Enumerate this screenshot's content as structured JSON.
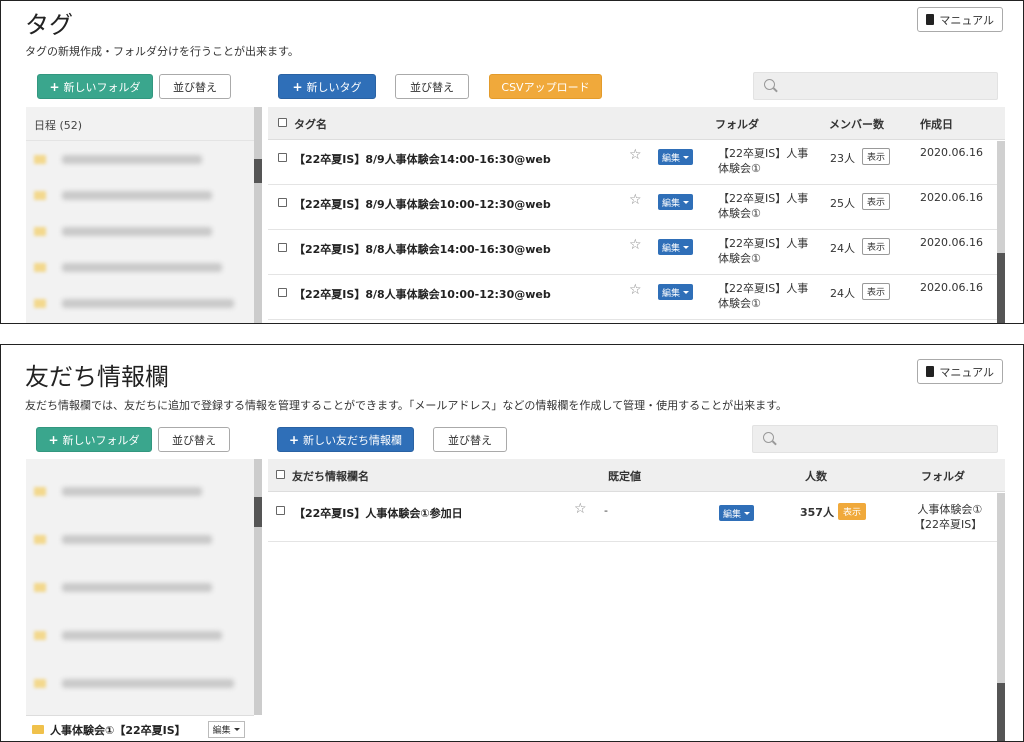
{
  "tags": {
    "title": "タグ",
    "description": "タグの新規作成・フォルダ分けを行うことが出来ます。",
    "manual_label": "マニュアル",
    "new_folder_label": "新しいフォルダ",
    "sort_label": "並び替え",
    "new_tag_label": "新しいタグ",
    "sort_label_2": "並び替え",
    "csv_upload_label": "CSVアップロード",
    "search_placeholder": "",
    "sidebar_head": "日程 (52)",
    "columns": {
      "name": "タグ名",
      "folder": "フォルダ",
      "members": "メンバー数",
      "created": "作成日"
    },
    "rows": [
      {
        "name": "【22卒夏IS】8/9人事体験会14:00-16:30@web",
        "edit": "編集",
        "folder_line1": "【22卒夏IS】人事",
        "folder_line2": "体験会①",
        "members": "23人",
        "show": "表示",
        "created": "2020.06.16"
      },
      {
        "name": "【22卒夏IS】8/9人事体験会10:00-12:30@web",
        "edit": "編集",
        "folder_line1": "【22卒夏IS】人事",
        "folder_line2": "体験会①",
        "members": "25人",
        "show": "表示",
        "created": "2020.06.16"
      },
      {
        "name": "【22卒夏IS】8/8人事体験会14:00-16:30@web",
        "edit": "編集",
        "folder_line1": "【22卒夏IS】人事",
        "folder_line2": "体験会①",
        "members": "24人",
        "show": "表示",
        "created": "2020.06.16"
      },
      {
        "name": "【22卒夏IS】8/8人事体験会10:00-12:30@web",
        "edit": "編集",
        "folder_line1": "【22卒夏IS】人事",
        "folder_line2": "体験会①",
        "members": "24人",
        "show": "表示",
        "created": "2020.06.16"
      }
    ]
  },
  "friends": {
    "title": "友だち情報欄",
    "description": "友だち情報欄では、友だちに追加で登録する情報を管理することができます。「メールアドレス」などの情報欄を作成して管理・使用することが出来ます。",
    "manual_label": "マニュアル",
    "new_folder_label": "新しいフォルダ",
    "sort_label": "並び替え",
    "new_field_label": "新しい友だち情報欄",
    "sort_label_2": "並び替え",
    "search_placeholder": "",
    "columns": {
      "name": "友だち情報欄名",
      "default": "既定値",
      "count": "人数",
      "folder": "フォルダ"
    },
    "rows": [
      {
        "name": "【22卒夏IS】人事体験会①参加日",
        "default": "-",
        "edit": "編集",
        "count": "357人",
        "show": "表示",
        "folder_line1": "人事体験会①",
        "folder_line2": "【22卒夏IS】"
      }
    ],
    "active_folder": "人事体験会①【22卒夏IS】",
    "active_folder_edit": "編集"
  },
  "icons": {
    "manual": "book-icon",
    "search": "search-icon",
    "star": "star-icon",
    "folder": "folder-icon"
  },
  "colors": {
    "green": "#3aa68d",
    "blue": "#2f6fb8",
    "orange": "#f0a93b"
  }
}
